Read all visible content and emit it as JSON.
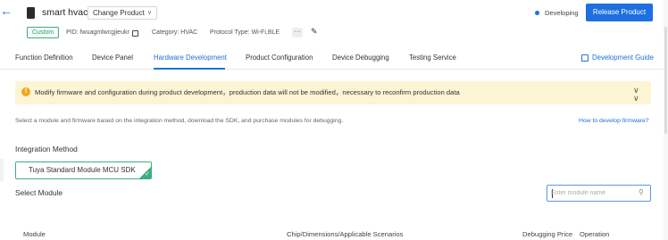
{
  "header": {
    "back_icon": "arrow-left-icon",
    "product_name": "smart hvac",
    "change_product_label": "Change Product",
    "status_label": "Developing",
    "release_button_label": "Release Product",
    "accent_color": "#1e6fe0"
  },
  "meta": {
    "badge": "Custom",
    "pid": "PID: fwuagmlwcgjieukr",
    "category": "Category: HVAC",
    "protocol": "Protocol Type: Wi-Fi,BLE",
    "more_label": "···"
  },
  "tabs": [
    {
      "label": "Function Definition",
      "active": false
    },
    {
      "label": "Device Panel",
      "active": false
    },
    {
      "label": "Hardware Development",
      "active": true
    },
    {
      "label": "Product Configuration",
      "active": false
    },
    {
      "label": "Device Debugging",
      "active": false
    },
    {
      "label": "Testing Service",
      "active": false
    }
  ],
  "dev_guide_label": "Development Guide",
  "notice": {
    "text": "Modify firmware and configuration during product development，production data will not be modified，necessary to reconfirm production data",
    "color": "#fdf4d4"
  },
  "description": "Select a module and firmware based on the integration method, download the SDK, and purchase modules for debugging.",
  "how_link": "How to develop firmware?",
  "integration": {
    "title": "Integration Method",
    "selected_option": "Tuya Standard Module MCU SDK",
    "selected_color": "#3cae7c"
  },
  "module": {
    "title": "Select Module",
    "search_placeholder": "Enter module name"
  },
  "table": {
    "columns": [
      "Module",
      "Chip/Dimensions/Applicable Scenarios",
      "Debugging Price",
      "Operation"
    ]
  }
}
